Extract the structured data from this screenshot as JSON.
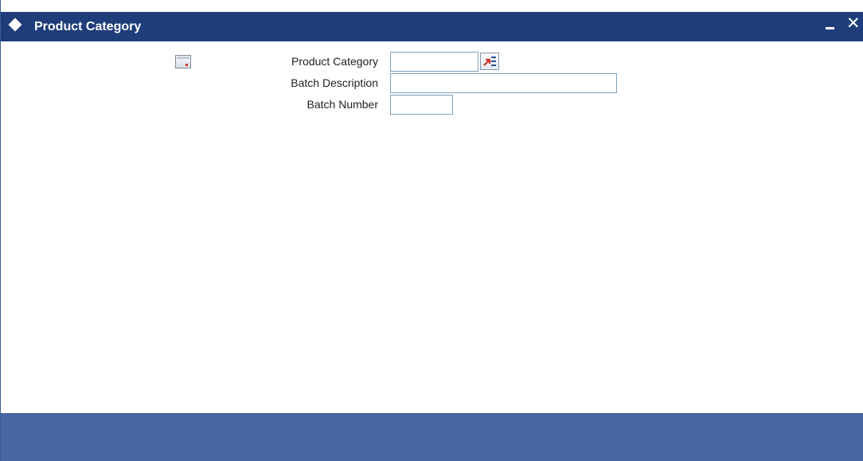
{
  "window": {
    "title": "Product Category",
    "minimize_label": "–",
    "close_label": "✕"
  },
  "toolbar": {
    "icon": "document-icon"
  },
  "form": {
    "product_category": {
      "label": "Product Category",
      "value": "",
      "lov_icon": "list-of-values-icon"
    },
    "batch_description": {
      "label": "Batch Description",
      "value": ""
    },
    "batch_number": {
      "label": "Batch Number",
      "value": ""
    }
  },
  "colors": {
    "titlebar": "#1e3d7a",
    "footer": "#4767a0",
    "input_border": "#7f9db9"
  }
}
